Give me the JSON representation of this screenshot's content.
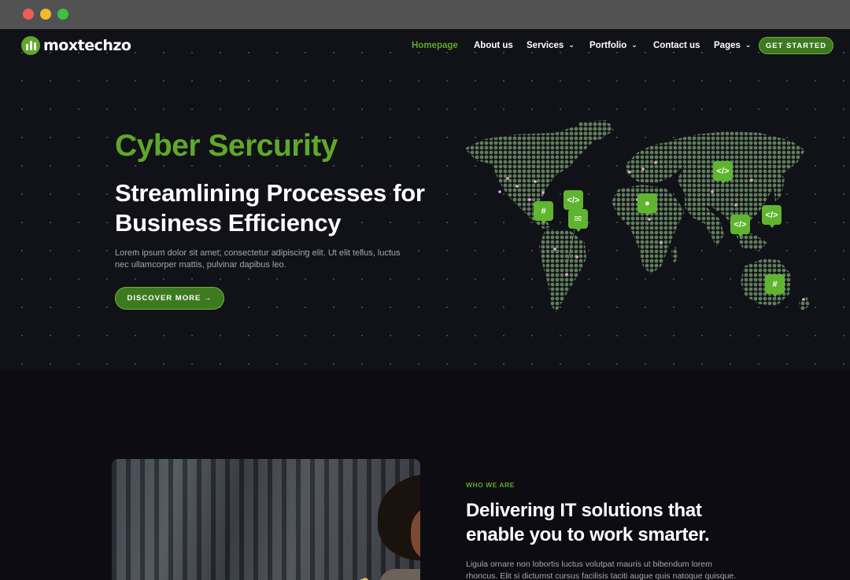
{
  "brand": {
    "name": "moxtechzo",
    "accent": "#5fa82a",
    "button_bg": "#3d7a1f",
    "background": "#111118"
  },
  "nav": {
    "items": [
      {
        "label": "Homepage",
        "active": true,
        "dropdown": false
      },
      {
        "label": "About us",
        "active": false,
        "dropdown": false
      },
      {
        "label": "Services",
        "active": false,
        "dropdown": true
      },
      {
        "label": "Portfolio",
        "active": false,
        "dropdown": true
      },
      {
        "label": "Contact us",
        "active": false,
        "dropdown": false
      },
      {
        "label": "Pages",
        "active": false,
        "dropdown": true
      }
    ],
    "cta": "GET STARTED",
    "chevron_icon": "chevron-down-icon"
  },
  "hero": {
    "title": "Cyber Sercurity",
    "headline": "Streamlining Processes for Business Efficiency",
    "description": "Lorem ipsum dolor sit amet, consectetur adipiscing elit. Ut elit tellus, luctus nec ullamcorper mattis, pulvinar dapibus leo.",
    "button": "DISCOVER MORE →"
  },
  "map": {
    "pins": [
      "slack-icon",
      "code-icon",
      "mail-icon",
      "github-icon",
      "code-icon",
      "code-icon",
      "code-icon",
      "slack-icon"
    ]
  },
  "about": {
    "eyebrow": "WHO WE ARE",
    "title": "Delivering IT solutions that enable you to work smarter.",
    "description": "Ligula ornare non lobortis luctus volutpat mauris ut bibendum lorem rhoncus. Elit si dictumst cursus facilisis taciti augue quis natoque quisque."
  }
}
